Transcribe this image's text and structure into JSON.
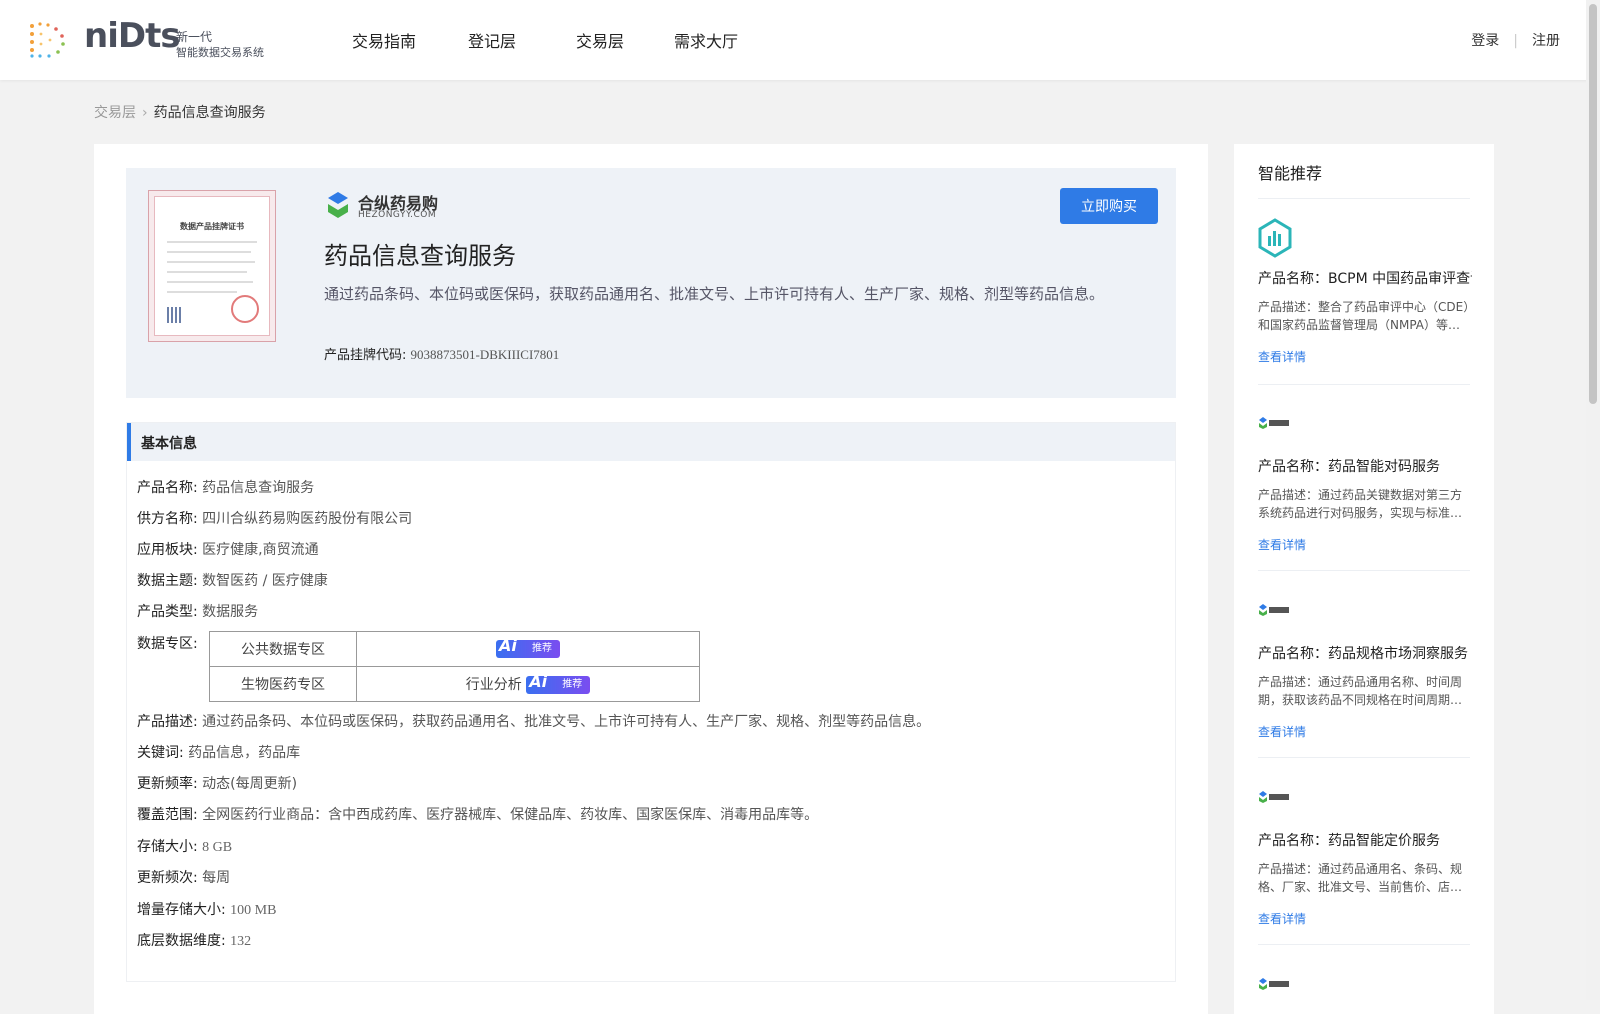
{
  "header": {
    "logo": {
      "word": "niDts",
      "sub1": "新一代",
      "sub2": "智能数据交易系统"
    },
    "nav": [
      "交易指南",
      "登记层",
      "交易层",
      "需求大厅"
    ],
    "login": "登录",
    "register": "注册"
  },
  "breadcrumb": {
    "parent": "交易层",
    "current": "药品信息查询服务"
  },
  "product": {
    "certificate_title": "数据产品挂牌证书",
    "brand_name": "合纵药易购",
    "brand_sub": "HEZONGYY.COM",
    "title": "药品信息查询服务",
    "description": "通过药品条码、本位码或医保码，获取药品通用名、批准文号、上市许可持有人、生产厂家、规格、剂型等药品信息。",
    "listing_code_label": "产品挂牌代码:",
    "listing_code": "9038873501-DBKIIICI7801",
    "buy_label": "立即购买"
  },
  "basic": {
    "title": "基本信息",
    "rows": [
      {
        "label": "产品名称:",
        "value": "药品信息查询服务"
      },
      {
        "label": "供方名称:",
        "value": "四川合纵药易购医药股份有限公司"
      },
      {
        "label": "应用板块:",
        "value": "医疗健康,商贸流通"
      },
      {
        "label": "数据主题:",
        "value": "数智医药 / 医疗健康"
      },
      {
        "label": "产品类型:",
        "value": "数据服务"
      }
    ],
    "zone_label": "数据专区:",
    "zones": [
      {
        "name": "公共数据专区",
        "prefix": "",
        "badge": "推荐"
      },
      {
        "name": "生物医药专区",
        "prefix": "行业分析",
        "badge": "推荐"
      }
    ],
    "rows2": [
      {
        "label": "产品描述:",
        "value": "通过药品条码、本位码或医保码，获取药品通用名、批准文号、上市许可持有人、生产厂家、规格、剂型等药品信息。"
      },
      {
        "label": "关键词:",
        "value": "药品信息，药品库"
      },
      {
        "label": "更新频率:",
        "value": "动态(每周更新)"
      },
      {
        "label": "覆盖范围:",
        "value": "全网医药行业商品：含中西成药库、医疗器械库、保健品库、药妆库、国家医保库、消毒用品库等。"
      },
      {
        "label": "存储大小:",
        "value": "8 GB"
      },
      {
        "label": "更新频次:",
        "value": "每周"
      },
      {
        "label": "增量存储大小:",
        "value": "100 MB"
      },
      {
        "label": "底层数据维度:",
        "value": "132"
      }
    ]
  },
  "sidebar": {
    "title": "智能推荐",
    "items": [
      {
        "name": "产品名称：BCPM 中国药品审评查询",
        "desc": "产品描述：整合了药品审评中心（CDE）和国家药品监督管理局（NMPA）等多个数据源的信息",
        "link": "查看详情",
        "logo": "analytics"
      },
      {
        "name": "产品名称：药品智能对码服务",
        "desc": "产品描述：通过药品关键数据对第三方系统药品进行对码服务，实现与标准药品库的匹配",
        "link": "查看详情",
        "logo": "brand"
      },
      {
        "name": "产品名称：药品规格市场洞察服务",
        "desc": "产品描述：通过药品通用名称、时间周期，获取该药品不同规格在时间周期内的市场表现",
        "link": "查看详情",
        "logo": "brand"
      },
      {
        "name": "产品名称：药品智能定价服务",
        "desc": "产品描述：通过药品通用名、条码、规格、厂家、批准文号、当前售价、店铺等信息提供定价建议",
        "link": "查看详情",
        "logo": "brand"
      }
    ]
  }
}
